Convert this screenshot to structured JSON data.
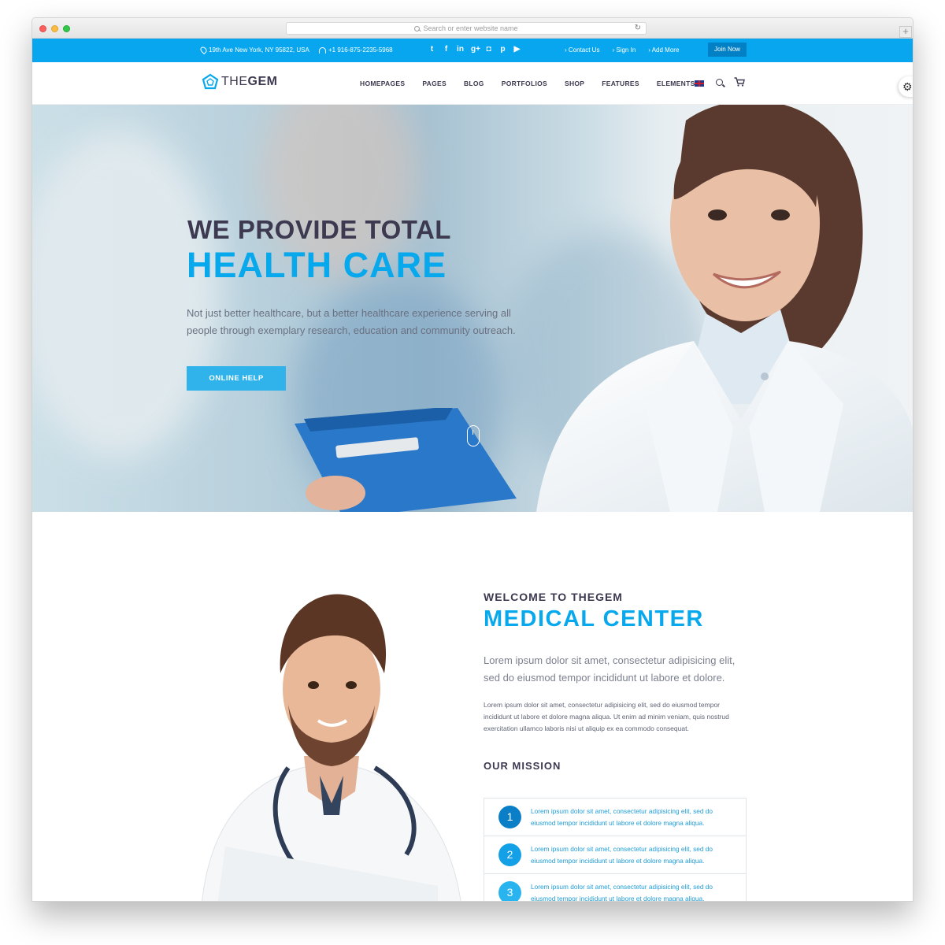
{
  "browser": {
    "url_placeholder": "Search or enter website name",
    "reload_icon": "reload-icon",
    "new_tab_icon": "plus-icon"
  },
  "topbar": {
    "address": "19th Ave New York, NY 95822, USA",
    "phone": "+1 916-875-2235-5968",
    "social_icons": [
      "twitter-icon",
      "facebook-icon",
      "linkedin-icon",
      "google-plus-icon",
      "instagram-icon",
      "pinterest-icon",
      "youtube-icon"
    ],
    "links": [
      "Contact Us",
      "Sign In",
      "Add More"
    ],
    "join_label": "Join Now",
    "background_color": "#07a6ee"
  },
  "navbar": {
    "logo_light": "THE",
    "logo_bold": "GEM",
    "menu": [
      "HOMEPAGES",
      "PAGES",
      "BLOG",
      "PORTFOLIOS",
      "SHOP",
      "FEATURES",
      "ELEMENTS"
    ],
    "icons": [
      "uk-flag-icon",
      "search-icon",
      "cart-icon",
      "gear-icon"
    ]
  },
  "hero": {
    "title": "WE PROVIDE TOTAL",
    "subtitle": "HEALTH CARE",
    "text_line1": "Not just better healthcare, but a better healthcare experience serving all",
    "text_line2": "people through exemplary research, education and community outreach.",
    "button_label": "ONLINE HELP",
    "accent_color": "#08a8ec"
  },
  "about": {
    "welcome": "WELCOME TO THEGEM",
    "title": "MEDICAL CENTER",
    "lead_line1": "Lorem ipsum dolor sit amet, consectetur adipisicing elit,",
    "lead_line2": "sed do eiusmod tempor incididunt ut labore et dolore.",
    "body_line1": "Lorem ipsum dolor sit amet, consectetur adipisicing elit, sed do eiusmod tempor",
    "body_line2": "incididunt ut labore et dolore magna aliqua. Ut enim ad minim veniam, quis nostrud",
    "body_line3": "exercitation ullamco laboris nisi ut aliquip ex ea commodo consequat.",
    "mission_title": "OUR MISSION",
    "mission_items": [
      {
        "number": "1",
        "line1": "Lorem ipsum dolor sit amet, consectetur adipisicing elit, sed do",
        "line2": "eiusmod tempor incididunt ut labore et dolore magna aliqua."
      },
      {
        "number": "2",
        "line1": "Lorem ipsum dolor sit amet, consectetur adipisicing elit, sed do",
        "line2": "eiusmod tempor incididunt ut labore et dolore magna aliqua."
      },
      {
        "number": "3",
        "line1": "Lorem ipsum dolor sit amet, consectetur adipisicing elit, sed do",
        "line2": "eiusmod tempor incididunt ut labore et dolore magna aliqua."
      }
    ]
  }
}
